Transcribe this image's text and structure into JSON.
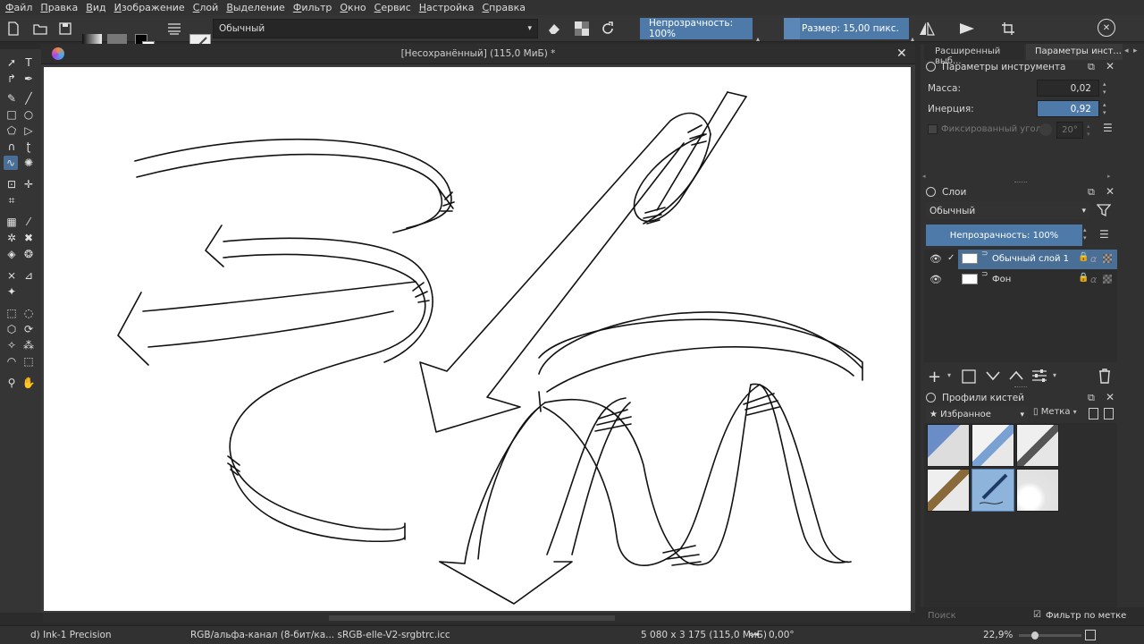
{
  "menu": [
    "Файл",
    "Правка",
    "Вид",
    "Изображение",
    "Слой",
    "Выделение",
    "Фильтр",
    "Окно",
    "Сервис",
    "Настройка",
    "Справка"
  ],
  "toolbar": {
    "blend_mode": "Обычный",
    "opacity_label": "Непрозрачность: 100%",
    "size_label": "Размер: 15,00 пикс."
  },
  "document": {
    "title": "[Несохранённый]  (115,0 МиБ) *"
  },
  "tool_options": {
    "tab_advanced": "Расширенный выб...",
    "tab_tool_options": "Параметры инст...",
    "panel_title": "Параметры инструмента",
    "mass_label": "Масса:",
    "mass_value": "0,02",
    "inertia_label": "Инерция:",
    "inertia_value": "0,92",
    "fixed_angle_label": "Фиксированный угол:",
    "fixed_angle_value": "20°"
  },
  "layers": {
    "panel_title": "Слои",
    "blend_mode": "Обычный",
    "opacity_label": "Непрозрачность:  100%",
    "items": [
      {
        "name": "Обычный слой 1",
        "selected": true
      },
      {
        "name": "Фон",
        "selected": false
      }
    ]
  },
  "brushes": {
    "panel_title": "Профили кистей",
    "filter_value": "★ Избранное",
    "tag_label": "Метка",
    "search_placeholder": "Поиск",
    "filter_by_tag": "Фильтр по метке"
  },
  "status": {
    "brush_name": "d) Ink-1 Precision",
    "color_profile": "RGB/альфа-канал (8-бит/ка... sRGB-elle-V2-srgbtrc.icc",
    "image_size": "5 080 x 3 175 (115,0 МиБ)",
    "rotation": "0,00°",
    "zoom": "22,9%"
  },
  "colors": {
    "accent": "#4d7aa8",
    "selection": "#4a6f96",
    "background": "#313131"
  }
}
